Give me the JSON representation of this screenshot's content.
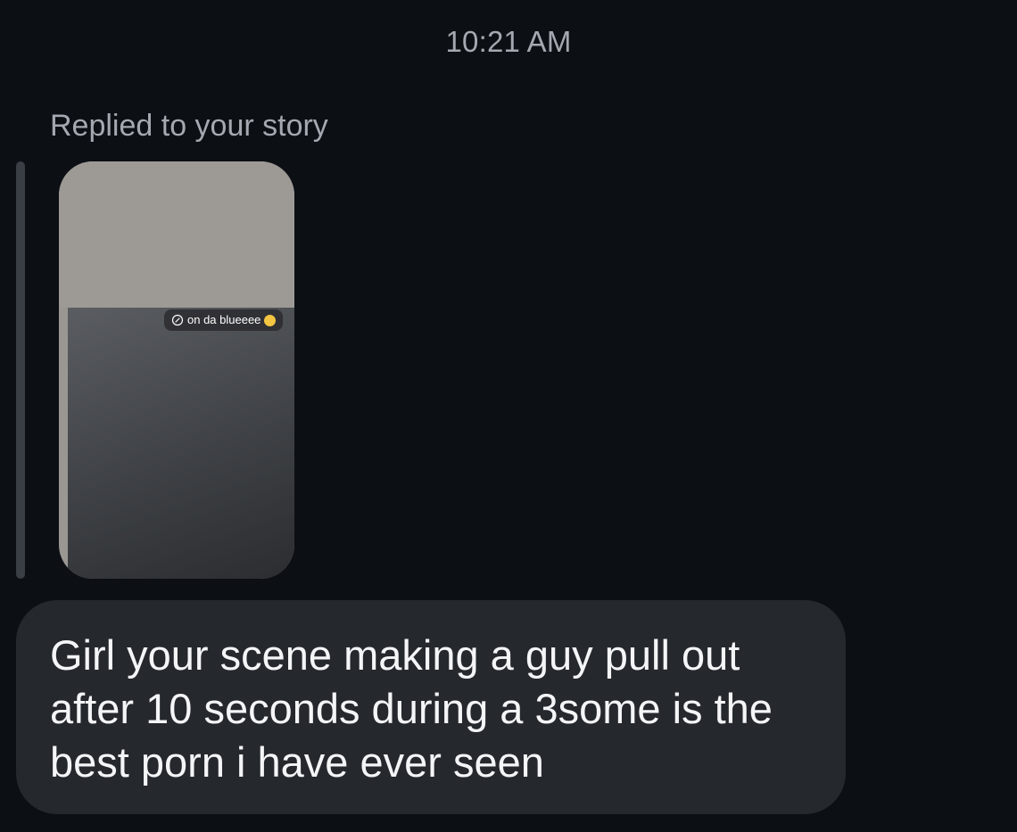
{
  "conversation": {
    "timestamp": "10:21 AM",
    "reply_context": {
      "label": "Replied to your story",
      "story_sticker_text": "on da blueeee",
      "story_sticker_icons": [
        "link-icon",
        "emoji-icon"
      ]
    },
    "message": {
      "text": "Girl your scene making a guy pull out after 10 seconds during a 3some is the best porn i have ever seen"
    }
  },
  "colors": {
    "background": "#0c0f14",
    "bubble": "#25282d",
    "secondary_text": "#a4a8b0",
    "primary_text": "#f4f5f7"
  }
}
